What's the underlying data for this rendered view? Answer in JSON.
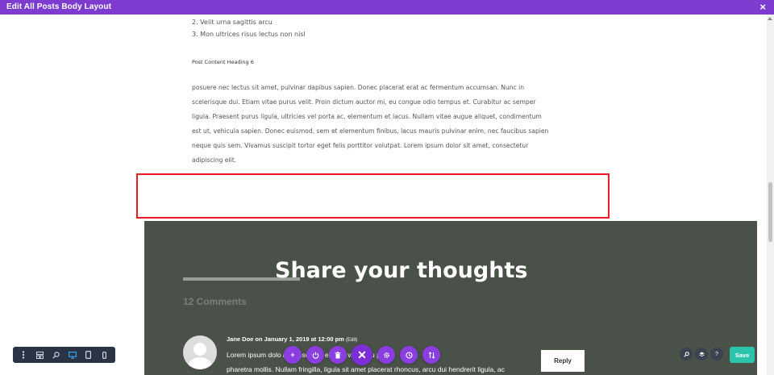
{
  "header": {
    "title": "Edit All Posts Body Layout",
    "close_icon": "close-icon"
  },
  "content": {
    "list_items": [
      "2. Velit urna sagittis arcu",
      "3. Mon ultrices risus lectus non nisl"
    ],
    "heading6": "Post Content Heading 6",
    "paragraph_lines": [
      "posuere nec lectus sit amet, pulvinar dapibus sapien. Donec placerat erat ac fermentum accumsan. Nunc in",
      "scelerisque dui. Etiam vitae purus velit. Proin dictum auctor mi, eu congue odio tempus et. Curabitur ac semper",
      "ligula. Praesent purus ligula, ultricies vel porta ac, elementum et lacus. Nullam vitae augue aliquet, condimentum",
      "est ut, vehicula sapien. Donec euismod, sem et elementum finibus, lacus mauris pulvinar enim, nec faucibus sapien",
      "neque quis sem. Vivamus suscipit tortor eget felis porttitor volutpat. Lorem ipsum dolor sit amet, consectetur",
      "adipiscing elit."
    ]
  },
  "comments": {
    "heading": "Share your thoughts",
    "count_label": "12 Comments",
    "first": {
      "author_line": "Jane Doe on January 1, 2019 at 12:00 pm",
      "edit_label": "(Edit)",
      "text_line1": "Lorem ipsum dolo    ame    nse    r ad    elit    sell    vin    lla eu purus",
      "text_line2": "pharetra mollis. Nullam fringilla, ligula sit amet placerat rhoncus, arcu dui hendrerit ligula, ac",
      "reply_label": "Reply"
    }
  },
  "builder_toolbar": {
    "left_icons": [
      "menu-icon",
      "layout-icon",
      "search-icon",
      "desktop-icon",
      "tablet-icon",
      "phone-icon"
    ],
    "center_icons": [
      "add-icon",
      "power-icon",
      "trash-icon",
      "close-icon",
      "settings-icon",
      "history-icon",
      "sort-icon"
    ],
    "right_icons": [
      "search-icon",
      "layers-icon",
      "help-icon"
    ],
    "save_label": "Save"
  },
  "colors": {
    "header_purple": "#7e3bd0",
    "selection_red": "#ed1c24",
    "dark_section": "#4a5148",
    "save_green": "#29c4a9",
    "fab_purple": "#8a3ee0"
  }
}
